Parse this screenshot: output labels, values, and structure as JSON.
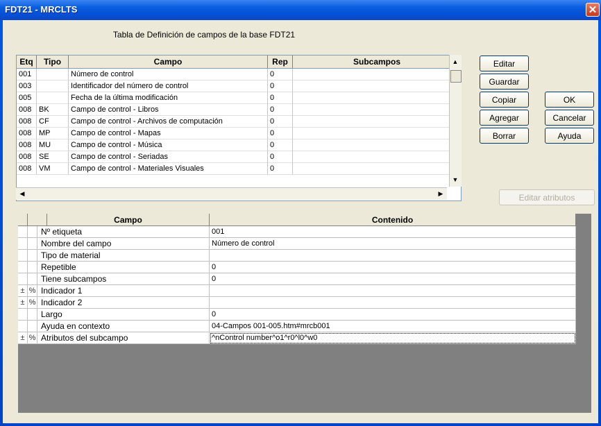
{
  "window": {
    "title": "FDT21 - MRCLTS",
    "close_glyph": "✕"
  },
  "caption": "Tabla de Definición de campos de la base FDT21",
  "fields_table": {
    "columns": [
      "Etq",
      "Tipo",
      "Campo",
      "Rep",
      "Subcampos"
    ],
    "rows": [
      {
        "etq": "001",
        "tipo": "",
        "campo": "Número de control",
        "rep": "0",
        "sub": ""
      },
      {
        "etq": "003",
        "tipo": "",
        "campo": "Identificador del número de control",
        "rep": "0",
        "sub": ""
      },
      {
        "etq": "005",
        "tipo": "",
        "campo": "Fecha de la última modificación",
        "rep": "0",
        "sub": ""
      },
      {
        "etq": "008",
        "tipo": "BK",
        "campo": "Campo de control - Libros",
        "rep": "0",
        "sub": ""
      },
      {
        "etq": "008",
        "tipo": "CF",
        "campo": "Campo de control - Archivos de computación",
        "rep": "0",
        "sub": ""
      },
      {
        "etq": "008",
        "tipo": "MP",
        "campo": "Campo de control - Mapas",
        "rep": "0",
        "sub": ""
      },
      {
        "etq": "008",
        "tipo": "MU",
        "campo": "Campo de control - Música",
        "rep": "0",
        "sub": ""
      },
      {
        "etq": "008",
        "tipo": "SE",
        "campo": "Campo de control - Seriadas",
        "rep": "0",
        "sub": ""
      },
      {
        "etq": "008",
        "tipo": "VM",
        "campo": "Campo de control - Materiales Visuales",
        "rep": "0",
        "sub": ""
      }
    ]
  },
  "buttons": {
    "editar": "Editar",
    "guardar": "Guardar",
    "copiar": "Copiar",
    "agregar": "Agregar",
    "borrar": "Borrar",
    "ok": "OK",
    "cancelar": "Cancelar",
    "ayuda": "Ayuda",
    "editar_atributos": "Editar atributos"
  },
  "detail_table": {
    "columns": [
      "Campo",
      "Contenido"
    ],
    "rows": [
      {
        "m1": "",
        "m2": "",
        "campo": "Nº etiqueta",
        "contenido": "001"
      },
      {
        "m1": "",
        "m2": "",
        "campo": "Nombre del campo",
        "contenido": "Número de control"
      },
      {
        "m1": "",
        "m2": "",
        "campo": "Tipo de material",
        "contenido": ""
      },
      {
        "m1": "",
        "m2": "",
        "campo": "Repetible",
        "contenido": "0"
      },
      {
        "m1": "",
        "m2": "",
        "campo": "Tiene subcampos",
        "contenido": "0"
      },
      {
        "m1": "±",
        "m2": "%",
        "campo": "Indicador 1",
        "contenido": ""
      },
      {
        "m1": "±",
        "m2": "%",
        "campo": "Indicador 2",
        "contenido": ""
      },
      {
        "m1": "",
        "m2": "",
        "campo": "Largo",
        "contenido": "0"
      },
      {
        "m1": "",
        "m2": "",
        "campo": "Ayuda en contexto",
        "contenido": "04-Campos 001-005.htm#mrcb001"
      },
      {
        "m1": "±",
        "m2": "%",
        "campo": "Atributos del subcampo",
        "contenido": "^nControl number^o1^r0^l0^w0"
      }
    ]
  }
}
